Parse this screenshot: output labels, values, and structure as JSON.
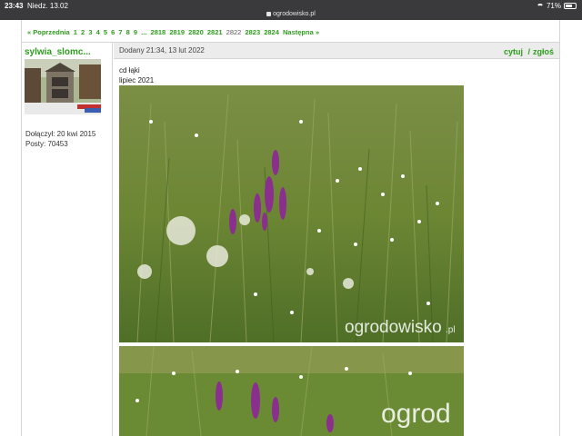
{
  "statusbar": {
    "time": "23:43",
    "date": "Niedz. 13.02",
    "url": "ogrodowisko.pl",
    "battery": "71%",
    "battery_level": 0.71
  },
  "pagination": {
    "prev": "« Poprzednia",
    "pages_start": [
      "1",
      "2",
      "3",
      "4",
      "5",
      "6",
      "7",
      "8",
      "9"
    ],
    "ellipsis": "...",
    "pages_end": [
      "2818",
      "2819",
      "2820",
      "2821"
    ],
    "current": "2822",
    "pages_after": [
      "2823",
      "2824"
    ],
    "next": "Następna »"
  },
  "user": {
    "name": "sylwia_slomc...",
    "joined": "Dołączył: 20 kwi 2015",
    "posts": "Posty: 70453"
  },
  "post": {
    "date": "Dodany 21:34, 13 lut 2022",
    "quote": "cytuj",
    "separator": "/",
    "report": "zgłoś",
    "lines": [
      "cd łąki",
      "lipiec 2021"
    ]
  },
  "photos": {
    "watermark1": "ogrodowisko",
    "watermark1_suffix": ".pl",
    "watermark2": "ogrod"
  },
  "colors": {
    "accent": "#2e9c1d",
    "meadow": "#6e8a3a",
    "flower_purple": "#8a2f8e"
  }
}
